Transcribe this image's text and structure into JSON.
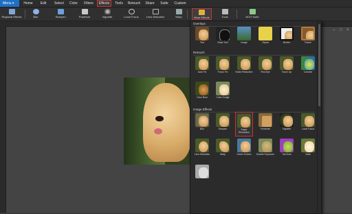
{
  "menubar": {
    "menu_label": "Menu",
    "tabs": [
      "Home",
      "Edit",
      "Select",
      "Color",
      "Filters",
      "Effects",
      "Tools",
      "Retouch",
      "Share",
      "Suite",
      "Custom"
    ],
    "active_tab": "Effects"
  },
  "toolbar": {
    "buttons": [
      "Regional Effects",
      "Blur",
      "Sharpen",
      "Posterize",
      "Vignette",
      "Local Focus",
      "Lens Distortion",
      "Warp",
      "More Effects",
      "Tools",
      "NCH Suite"
    ],
    "active_button": "More Effects"
  },
  "dropdown": {
    "sections": {
      "overlays": "Overlays",
      "retouch": "Retouch",
      "image_effects": "Image Effects"
    },
    "overlays": [
      "Text",
      "Draw Tool",
      "Image",
      "Clipart",
      "Border",
      "Frame"
    ],
    "retouch": [
      "Auto Fix",
      "Focus Fix",
      "Noise Reduction",
      "Red-Eye",
      "Touch Up",
      "Colorize",
      "Color Burn",
      "Color Dodge"
    ],
    "image_effects": [
      "Blur",
      "Sharpen",
      "Super Resolution",
      "Posterize",
      "Vignette",
      "Local Focus",
      "Lens Distortion",
      "Warp",
      "Green Screen",
      "Double Exposure",
      "TwoTone",
      "Glow"
    ],
    "active_item": "Super Resolution"
  },
  "colors": {
    "accent": "#1f6fc4",
    "highlight": "#cc3333"
  }
}
